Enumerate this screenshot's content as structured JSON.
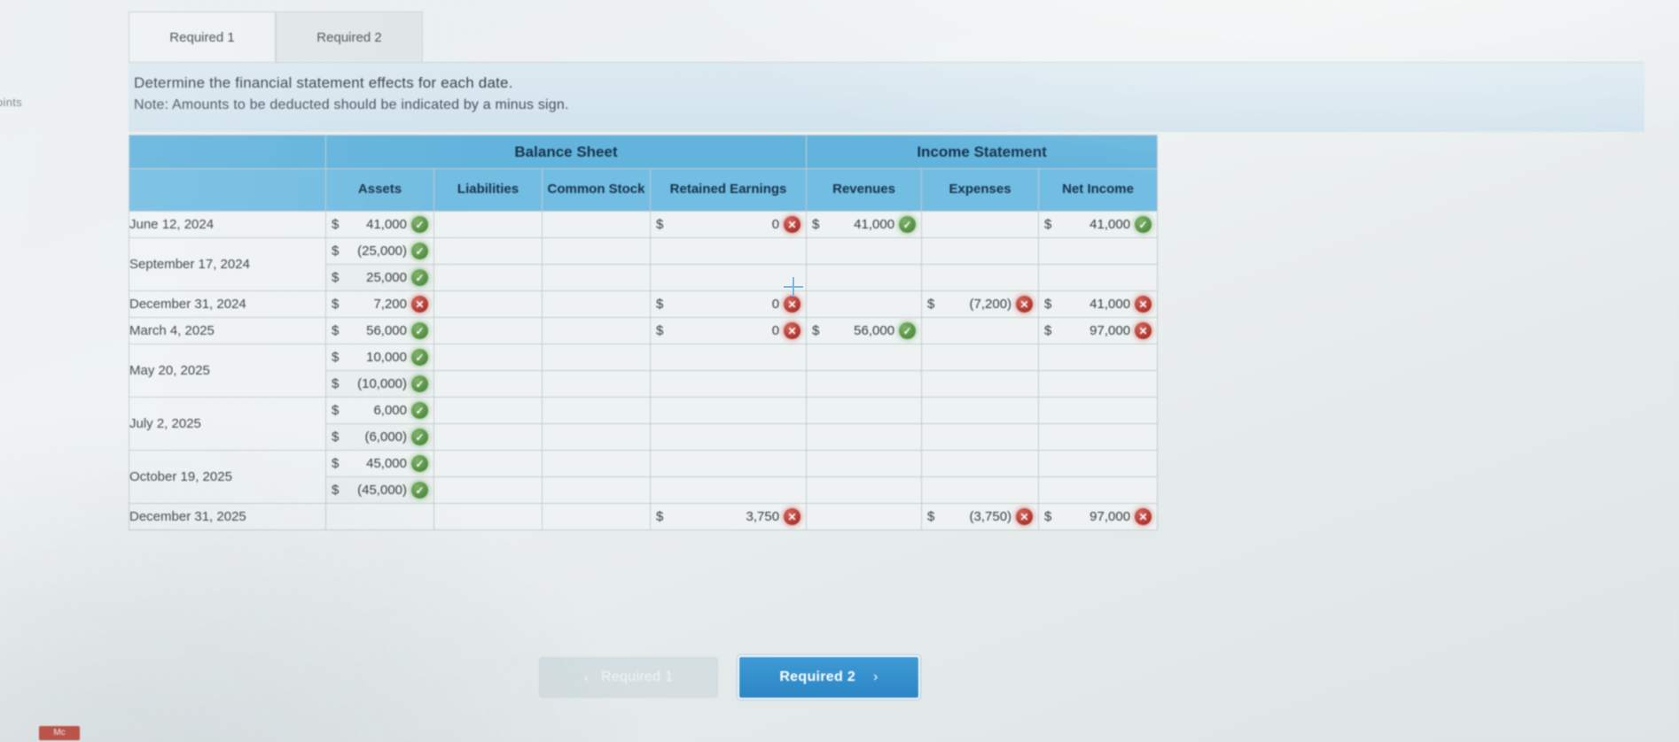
{
  "gutter": {
    "points_label": "oints"
  },
  "corner_chip": {
    "label": "Mc"
  },
  "tabs": [
    {
      "label": "Required 1",
      "active": true
    },
    {
      "label": "Required 2",
      "active": false
    }
  ],
  "instructions": {
    "line1": "Determine the financial statement effects for each date.",
    "line2": "Note: Amounts to be deducted should be indicated by a minus sign."
  },
  "table": {
    "group_headers": [
      {
        "label": "",
        "span": 1
      },
      {
        "label": "Balance Sheet",
        "span": 4
      },
      {
        "label": "Income Statement",
        "span": 3
      }
    ],
    "columns": [
      "",
      "Assets",
      "Liabilities",
      "Common Stock",
      "Retained Earnings",
      "Revenues",
      "Expenses",
      "Net Income"
    ],
    "rows": [
      {
        "date": "June 12, 2024",
        "lines": [
          {
            "assets": {
              "dollar": "$",
              "amount": "41,000",
              "mark": "ok"
            },
            "liabilities": null,
            "common_stock": null,
            "retained_earnings": {
              "dollar": "$",
              "amount": "0",
              "mark": "no"
            },
            "revenues": {
              "dollar": "$",
              "amount": "41,000",
              "mark": "ok"
            },
            "expenses": null,
            "net_income": {
              "dollar": "$",
              "amount": "41,000",
              "mark": "ok"
            }
          }
        ]
      },
      {
        "date": "September 17, 2024",
        "lines": [
          {
            "assets": {
              "dollar": "$",
              "amount": "(25,000)",
              "mark": "ok"
            },
            "liabilities": null,
            "common_stock": null,
            "retained_earnings": null,
            "revenues": null,
            "expenses": null,
            "net_income": null
          },
          {
            "assets": {
              "dollar": "$",
              "amount": "25,000",
              "mark": "ok"
            },
            "liabilities": null,
            "common_stock": null,
            "retained_earnings": null,
            "revenues": null,
            "expenses": null,
            "net_income": null
          }
        ]
      },
      {
        "date": "December 31, 2024",
        "lines": [
          {
            "assets": {
              "dollar": "$",
              "amount": "7,200",
              "mark": "no"
            },
            "liabilities": null,
            "common_stock": null,
            "retained_earnings": {
              "dollar": "$",
              "amount": "0",
              "mark": "no"
            },
            "revenues": null,
            "expenses": {
              "dollar": "$",
              "amount": "(7,200)",
              "mark": "no"
            },
            "net_income": {
              "dollar": "$",
              "amount": "41,000",
              "mark": "no"
            }
          }
        ]
      },
      {
        "date": "March 4, 2025",
        "lines": [
          {
            "assets": {
              "dollar": "$",
              "amount": "56,000",
              "mark": "ok"
            },
            "liabilities": null,
            "common_stock": null,
            "retained_earnings": {
              "dollar": "$",
              "amount": "0",
              "mark": "no"
            },
            "revenues": {
              "dollar": "$",
              "amount": "56,000",
              "mark": "ok"
            },
            "expenses": null,
            "net_income": {
              "dollar": "$",
              "amount": "97,000",
              "mark": "no"
            }
          }
        ]
      },
      {
        "date": "May 20, 2025",
        "lines": [
          {
            "assets": {
              "dollar": "$",
              "amount": "10,000",
              "mark": "ok"
            },
            "liabilities": null,
            "common_stock": null,
            "retained_earnings": null,
            "revenues": null,
            "expenses": null,
            "net_income": null
          },
          {
            "assets": {
              "dollar": "$",
              "amount": "(10,000)",
              "mark": "ok"
            },
            "liabilities": null,
            "common_stock": null,
            "retained_earnings": null,
            "revenues": null,
            "expenses": null,
            "net_income": null
          }
        ]
      },
      {
        "date": "July 2, 2025",
        "lines": [
          {
            "assets": {
              "dollar": "$",
              "amount": "6,000",
              "mark": "ok"
            },
            "liabilities": null,
            "common_stock": null,
            "retained_earnings": null,
            "revenues": null,
            "expenses": null,
            "net_income": null
          },
          {
            "assets": {
              "dollar": "$",
              "amount": "(6,000)",
              "mark": "ok"
            },
            "liabilities": null,
            "common_stock": null,
            "retained_earnings": null,
            "revenues": null,
            "expenses": null,
            "net_income": null
          }
        ]
      },
      {
        "date": "October 19, 2025",
        "lines": [
          {
            "assets": {
              "dollar": "$",
              "amount": "45,000",
              "mark": "ok"
            },
            "liabilities": null,
            "common_stock": null,
            "retained_earnings": null,
            "revenues": null,
            "expenses": null,
            "net_income": null
          },
          {
            "assets": {
              "dollar": "$",
              "amount": "(45,000)",
              "mark": "ok"
            },
            "liabilities": null,
            "common_stock": null,
            "retained_earnings": null,
            "revenues": null,
            "expenses": null,
            "net_income": null
          }
        ]
      },
      {
        "date": "December 31, 2025",
        "lines": [
          {
            "assets": null,
            "liabilities": null,
            "common_stock": null,
            "retained_earnings": {
              "dollar": "$",
              "amount": "3,750",
              "mark": "no"
            },
            "revenues": null,
            "expenses": {
              "dollar": "$",
              "amount": "(3,750)",
              "mark": "no"
            },
            "net_income": {
              "dollar": "$",
              "amount": "97,000",
              "mark": "no"
            }
          }
        ]
      }
    ]
  },
  "nav": {
    "prev_label": "Required 1",
    "prev_chevron": "‹",
    "next_label": "Required 2",
    "next_chevron": "›"
  },
  "marks": {
    "ok_glyph": "✓",
    "no_glyph": "✕"
  },
  "colors": {
    "header_blue": "#63b4dd",
    "next_button_blue": "#2b85c4",
    "ok_green": "#4e8b3d",
    "error_red": "#ab2f28",
    "instruction_band": "#d7e6ef"
  }
}
